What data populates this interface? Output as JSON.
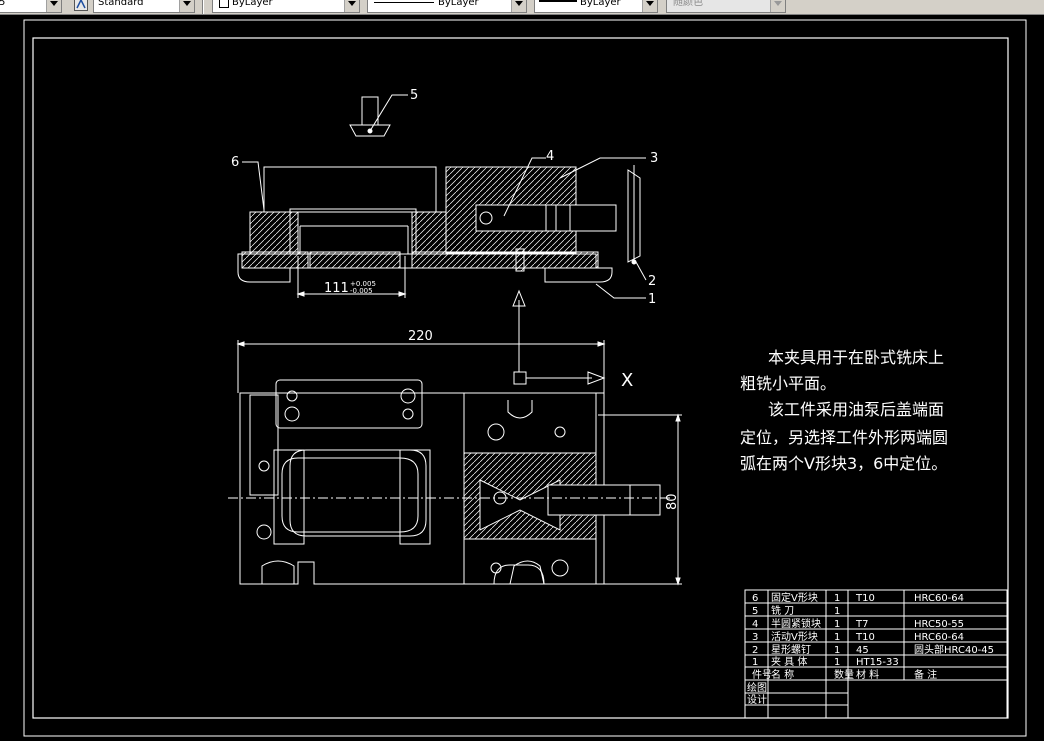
{
  "toolbar": {
    "dimstyle_partial": "5",
    "text_style": "Standard",
    "layer_color": "ByLayer",
    "linetype": "ByLayer",
    "lineweight": "ByLayer",
    "plot_style": "随颜色"
  },
  "drawing": {
    "balloons": [
      "1",
      "2",
      "3",
      "4",
      "5",
      "6"
    ],
    "dim_top": "111",
    "dim_top_tol_upper": "+0.005",
    "dim_top_tol_lower": "-0.005",
    "dim_width": "220",
    "dim_height": "80",
    "axis_label": "X",
    "description": [
      "本夹具用于在卧式铣床上",
      "粗铣小平面。",
      "该工件采用油泵后盖端面",
      "定位，另选择工件外形两端圆",
      "弧在两个V形块3，6中定位。"
    ]
  },
  "bom": {
    "rows": [
      {
        "no": "6",
        "name": "固定V形块",
        "qty": "1",
        "material": "T10",
        "note": "HRC60-64"
      },
      {
        "no": "5",
        "name": "铣  刀",
        "qty": "1",
        "material": "",
        "note": ""
      },
      {
        "no": "4",
        "name": "半圆紧锁块",
        "qty": "1",
        "material": "T7",
        "note": "HRC50-55"
      },
      {
        "no": "3",
        "name": "活动V形块",
        "qty": "1",
        "material": "T10",
        "note": "HRC60-64"
      },
      {
        "no": "2",
        "name": "星形螺钉",
        "qty": "1",
        "material": "45",
        "note": "圆头部HRC40-45"
      },
      {
        "no": "1",
        "name": "夹 具 体",
        "qty": "1",
        "material": "HT15-33",
        "note": ""
      }
    ],
    "header": {
      "no": "件号",
      "name": "名  称",
      "qty": "数量",
      "material": "材 料",
      "note": "备  注"
    },
    "footer": [
      "绘图",
      "设计"
    ]
  }
}
